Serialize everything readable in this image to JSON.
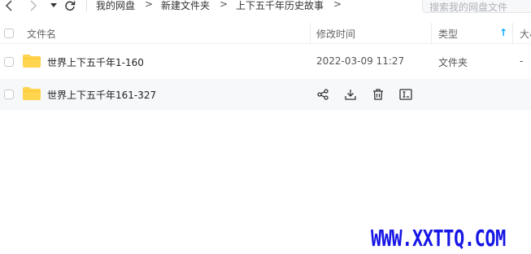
{
  "nav": {
    "back_icon": "chevron-left-icon",
    "forward_icon": "chevron-right-icon",
    "refresh_icon": "refresh-icon"
  },
  "breadcrumb": [
    {
      "label": "我的网盘"
    },
    {
      "label": "新建文件夹"
    },
    {
      "label": "上下五千年历史故事"
    }
  ],
  "breadcrumb_sep": ">",
  "search": {
    "placeholder": "搜索我的网盘文件"
  },
  "table": {
    "headers": {
      "name": "文件名",
      "modified": "修改时间",
      "type": "类型",
      "size": "大小"
    },
    "sort_indicator": "↑",
    "rows": [
      {
        "name": "世界上下五千年1-160",
        "modified": "2022-03-09 11:27",
        "type": "文件夹",
        "size": "-"
      },
      {
        "name": "世界上下五千年161-327",
        "modified": "",
        "type": "",
        "size": ""
      }
    ]
  },
  "row_actions": [
    "share-icon",
    "download-icon",
    "delete-icon",
    "rename-icon"
  ],
  "colors": {
    "folder": "#ffd44f",
    "accent": "#06a7ff",
    "watermark": "#1515e6"
  },
  "watermark": "WWW.XXTTQ.COM"
}
